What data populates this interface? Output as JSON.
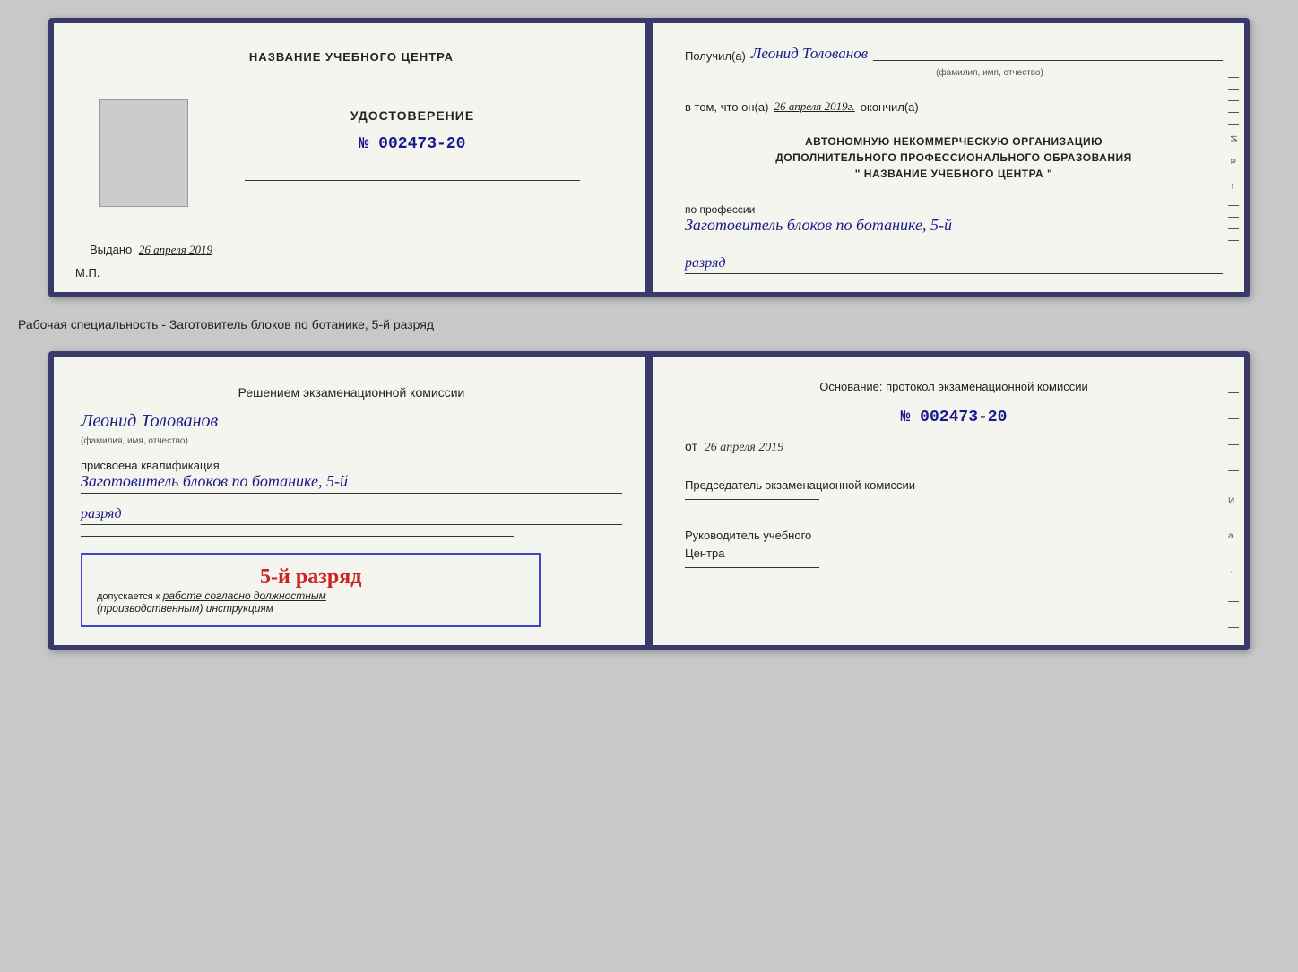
{
  "doc1": {
    "left": {
      "center_title": "НАЗВАНИЕ УЧЕБНОГО ЦЕНТРА",
      "cert_title": "УДОСТОВЕРЕНИЕ",
      "cert_number": "№ 002473-20",
      "issued_label": "Выдано",
      "issued_date": "26 апреля 2019",
      "mp_label": "М.П."
    },
    "right": {
      "received_prefix": "Получил(а)",
      "recipient_name": "Леонид Толованов",
      "fio_label": "(фамилия, имя, отчество)",
      "in_that_prefix": "в том, что он(а)",
      "date_value": "26 апреля 2019г.",
      "finished_label": "окончил(а)",
      "org_block_line1": "АВТОНОМНУЮ НЕКОММЕРЧЕСКУЮ ОРГАНИЗАЦИЮ",
      "org_block_line2": "ДОПОЛНИТЕЛЬНОГО ПРОФЕССИОНАЛЬНОГО ОБРАЗОВАНИЯ",
      "org_block_line3": "\" НАЗВАНИЕ УЧЕБНОГО ЦЕНТРА \"",
      "profession_label": "по профессии",
      "profession_value": "Заготовитель блоков по ботанике, 5-й",
      "razryad_value": "разряд"
    }
  },
  "separator": {
    "text": "Рабочая специальность - Заготовитель блоков по ботанике, 5-й разряд"
  },
  "doc2": {
    "left": {
      "decision_prefix": "Решением экзаменационной комиссии",
      "person_name": "Леонид Толованов",
      "fio_label": "(фамилия, имя, отчество)",
      "qualification_label": "присвоена квалификация",
      "qualification_value": "Заготовитель блоков по ботанике, 5-й",
      "razryad_value": "разряд",
      "stamp_big": "5-й разряд",
      "stamp_prefix": "допускается к",
      "stamp_italic": "работе согласно должностным",
      "stamp_italic2": "(производственным) инструкциям"
    },
    "right": {
      "basis_label": "Основание: протокол экзаменационной комиссии",
      "cert_number": "№ 002473-20",
      "from_label": "от",
      "from_date": "26 апреля 2019",
      "chairman_label": "Председатель экзаменационной комиссии",
      "director_label": "Руководитель учебного",
      "center_label": "Центра"
    }
  }
}
